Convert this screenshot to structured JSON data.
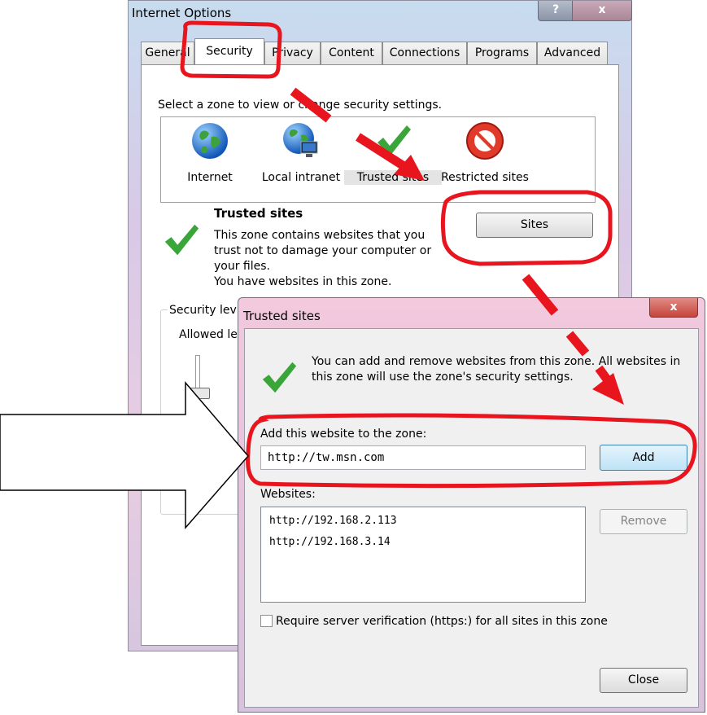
{
  "internet_options": {
    "title": "Internet Options",
    "help_symbol": "?",
    "close_symbol": "x",
    "tabs": [
      "General",
      "Security",
      "Privacy",
      "Content",
      "Connections",
      "Programs",
      "Advanced"
    ],
    "active_tab": "Security",
    "zone_caption": "Select a zone to view or change security settings.",
    "zones": [
      {
        "label": "Internet",
        "icon": "globe-icon"
      },
      {
        "label": "Local intranet",
        "icon": "intranet-globe-icon"
      },
      {
        "label": "Trusted sites",
        "icon": "checkmark-icon"
      },
      {
        "label": "Restricted sites",
        "icon": "prohibited-icon"
      }
    ],
    "selected_zone": "Trusted sites",
    "trusted_heading": "Trusted sites",
    "trusted_desc_1": "This zone contains websites that you trust not to damage your computer or your files.",
    "trusted_desc_2": "You have websites in this zone.",
    "sites_button": "Sites",
    "security_level_label": "Security lev",
    "allowed_label": "Allowed le"
  },
  "trusted_sites_dialog": {
    "title": "Trusted sites",
    "close_symbol": "x",
    "info_text": "You can add and remove websites from this zone. All websites in this zone will use the zone's security settings.",
    "add_label": "Add this website to the zone:",
    "url_value": "http://tw.msn.com",
    "add_button": "Add",
    "websites_label": "Websites:",
    "websites": [
      "http://192.168.2.113",
      "http://192.168.3.14"
    ],
    "remove_button": "Remove",
    "https_checkbox_label": "Require server verification (https:) for all sites in this zone",
    "https_checked": false,
    "close_button": "Close"
  },
  "annotation_colors": {
    "highlight": "#e8141e",
    "arrow_fill": "#ffffff",
    "arrow_stroke": "#000000"
  }
}
